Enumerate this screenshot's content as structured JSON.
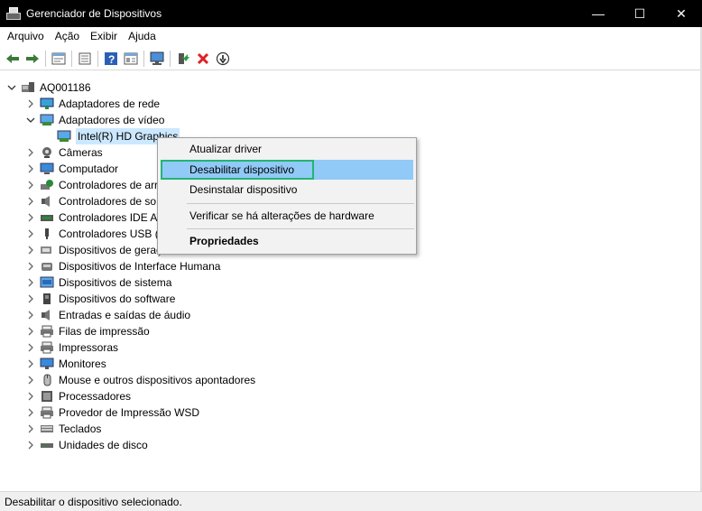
{
  "window": {
    "title": "Gerenciador de Dispositivos",
    "minimize": "—",
    "maximize": "☐",
    "close": "✕"
  },
  "menubar": {
    "items": [
      "Arquivo",
      "Ação",
      "Exibir",
      "Ajuda"
    ]
  },
  "toolbar": {
    "icons": [
      "back-icon",
      "forward-icon",
      "properties-icon",
      "show-hidden-icon",
      "help-icon",
      "view-icon",
      "monitor-icon",
      "update-driver-icon",
      "uninstall-icon",
      "disable-icon"
    ]
  },
  "tree": {
    "root": "AQ001186",
    "items": [
      {
        "label": "Adaptadores de rede",
        "expanded": false,
        "icon": "network-icon"
      },
      {
        "label": "Adaptadores de vídeo",
        "expanded": true,
        "icon": "display-adapter-icon"
      },
      {
        "label": "Intel(R) HD Graphics",
        "child": true,
        "selected": true,
        "icon": "display-adapter-icon"
      },
      {
        "label": "Câmeras",
        "icon": "camera-icon"
      },
      {
        "label": "Computador",
        "icon": "computer-icon"
      },
      {
        "label": "Controladores de arr",
        "icon": "storage-controller-icon"
      },
      {
        "label": "Controladores de so",
        "icon": "sound-controller-icon"
      },
      {
        "label": "Controladores IDE AT",
        "icon": "ide-controller-icon"
      },
      {
        "label": "Controladores USB (l",
        "icon": "usb-icon"
      },
      {
        "label": "Dispositivos de geraç",
        "icon": "imaging-icon"
      },
      {
        "label": "Dispositivos de Interface Humana",
        "icon": "hid-icon"
      },
      {
        "label": "Dispositivos de sistema",
        "icon": "system-device-icon"
      },
      {
        "label": "Dispositivos do software",
        "icon": "software-device-icon"
      },
      {
        "label": "Entradas e saídas de áudio",
        "icon": "audio-icon"
      },
      {
        "label": "Filas de impressão",
        "icon": "print-queue-icon"
      },
      {
        "label": "Impressoras",
        "icon": "printer-icon"
      },
      {
        "label": "Monitores",
        "icon": "monitor-icon"
      },
      {
        "label": "Mouse e outros dispositivos apontadores",
        "icon": "mouse-icon"
      },
      {
        "label": "Processadores",
        "icon": "processor-icon"
      },
      {
        "label": "Provedor de Impressão WSD",
        "icon": "printer-icon"
      },
      {
        "label": "Teclados",
        "icon": "keyboard-icon"
      },
      {
        "label": "Unidades de disco",
        "icon": "disk-icon"
      }
    ]
  },
  "context_menu": {
    "items": [
      {
        "label": "Atualizar driver"
      },
      {
        "label": "Desabilitar dispositivo",
        "highlighted": true
      },
      {
        "label": "Desinstalar dispositivo"
      },
      {
        "label": "Verificar se há alterações de hardware"
      },
      {
        "label": "Propriedades",
        "bold": true
      }
    ]
  },
  "statusbar": {
    "text": "Desabilitar o dispositivo selecionado."
  },
  "colors": {
    "titlebar": "#000000",
    "highlight": "#91c9f7",
    "focus_ring": "#22b573"
  }
}
